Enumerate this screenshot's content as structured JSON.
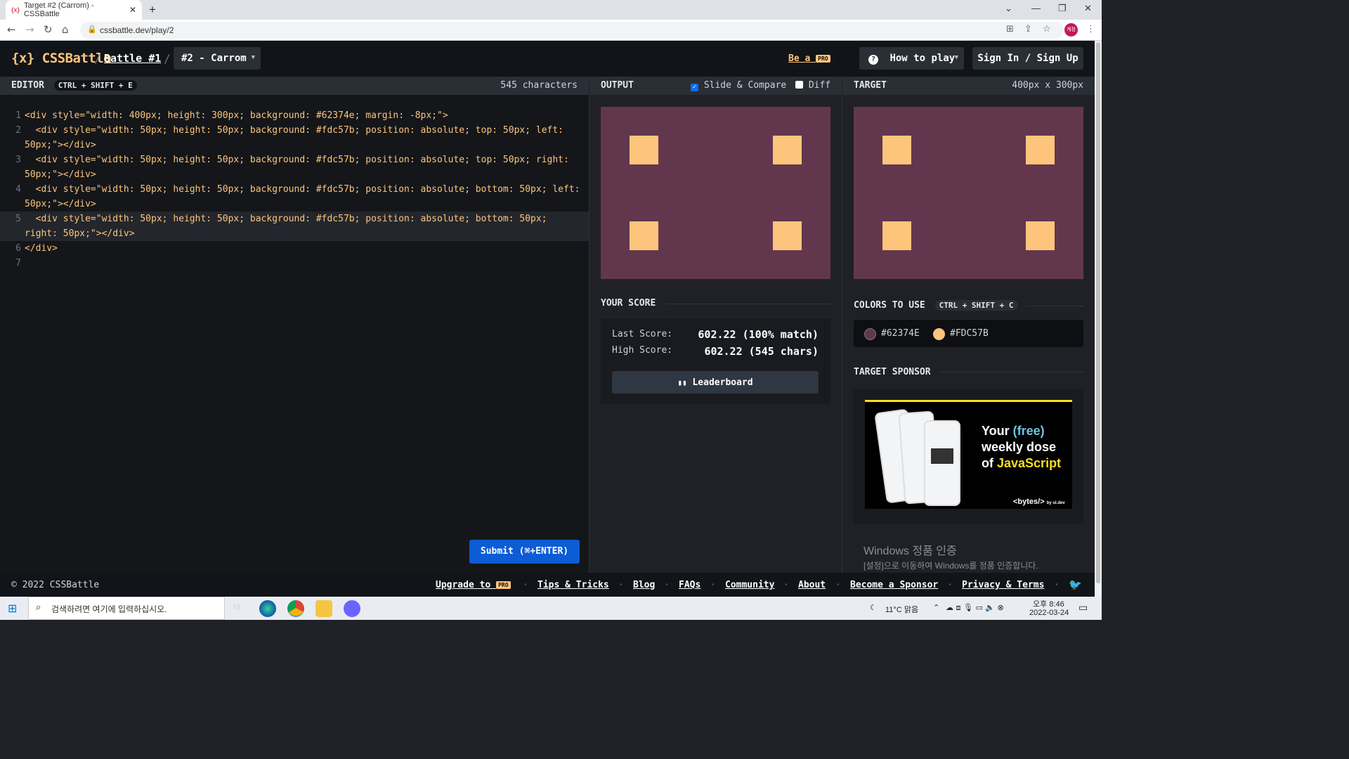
{
  "browser": {
    "tab_title": "Target #2 (Carrom) - CSSBattle",
    "favicon": "{x}",
    "url": "cssbattle.dev/play/2",
    "profile": "계정"
  },
  "header": {
    "logo": "{x} CSSBattle",
    "sep1": "/",
    "battle": "Battle #1",
    "sep2": "/",
    "target": "#2 - Carrom",
    "be_a": "Be a",
    "pro": "PRO",
    "how_to_play": "How to play",
    "sign_in": "Sign In / Sign Up"
  },
  "editor": {
    "label": "EDITOR",
    "shortcut": "CTRL + SHIFT + E",
    "chars": "545 characters",
    "lines": [
      {
        "n": "1",
        "t": [
          "<div style=\"width: 400px; height: 300px; background: #62374e; margin: -8px;\">"
        ]
      },
      {
        "n": "2",
        "t": [
          "  <div style=\"width: 50px; height: 50px; background: #fdc57b; position: absolute; top: 50px; left:",
          "50px;\"></div>"
        ]
      },
      {
        "n": "3",
        "t": [
          "  <div style=\"width: 50px; height: 50px; background: #fdc57b; position: absolute; top: 50px; right:",
          "50px;\"></div>"
        ]
      },
      {
        "n": "4",
        "t": [
          "  <div style=\"width: 50px; height: 50px; background: #fdc57b; position: absolute; bottom: 50px; left:",
          "50px;\"></div>"
        ]
      },
      {
        "n": "5",
        "t": [
          "  <div style=\"width: 50px; height: 50px; background: #fdc57b; position: absolute; bottom: 50px;",
          "right: 50px;\"></div>"
        ]
      },
      {
        "n": "6",
        "t": [
          "</div>"
        ]
      },
      {
        "n": "7",
        "t": [
          ""
        ]
      }
    ],
    "submit": "Submit (⌘+ENTER)"
  },
  "output": {
    "label": "OUTPUT",
    "slide_compare": "Slide & Compare",
    "slide_checked": true,
    "diff": "Diff",
    "diff_checked": false
  },
  "target": {
    "label": "TARGET",
    "size": "400px x 300px"
  },
  "score": {
    "title": "YOUR SCORE",
    "last_label": "Last Score:",
    "last_value": "602.22 (100% match)",
    "high_label": "High Score:",
    "high_value": "602.22 (545 chars)",
    "leaderboard": "Leaderboard"
  },
  "colors_to_use": {
    "title": "COLORS TO USE",
    "shortcut": "CTRL + SHIFT + C",
    "c1": "#62374E",
    "c2": "#FDC57B",
    "c1_hex": "#62374e",
    "c2_hex": "#fdc57b"
  },
  "sponsor": {
    "title": "TARGET SPONSOR",
    "ad_line1": "Your ",
    "ad_free": "(free)",
    "ad_line2": "weekly dose",
    "ad_line3": "of ",
    "ad_js": "JavaScript",
    "ad_brand": "<bytes/>",
    "ad_by": "by ui.dev"
  },
  "windows_activation": {
    "title": "Windows 정품 인증",
    "subtitle": "[설정]으로 이동하여 Windows를 정품 인증합니다."
  },
  "footer": {
    "copyright": "© 2022 CSSBattle",
    "upgrade": "Upgrade to",
    "pro": "PRO",
    "tips": "Tips & Tricks",
    "blog": "Blog",
    "faqs": "FAQs",
    "community": "Community",
    "about": "About",
    "sponsor": "Become a Sponsor",
    "privacy": "Privacy & Terms",
    "sep": "·"
  },
  "taskbar": {
    "search": "검색하려면 여기에 입력하십시오.",
    "weather": "11°C 맑음",
    "time": "오후 8:46",
    "date": "2022-03-24"
  }
}
